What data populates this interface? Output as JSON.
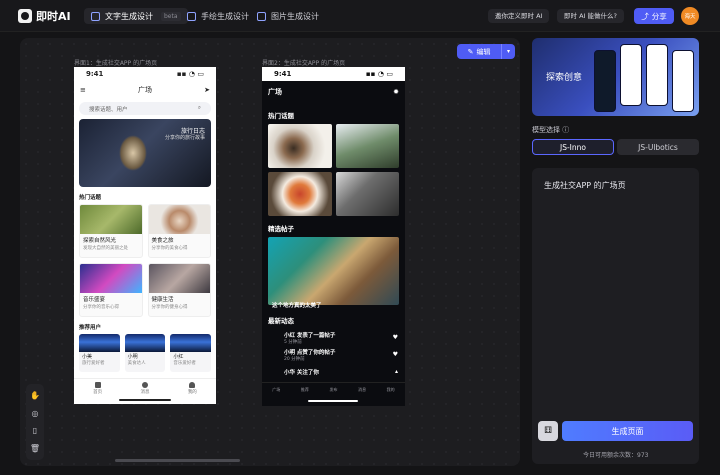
{
  "app": {
    "name": "即时AI"
  },
  "tabs": [
    {
      "label": "文字生成设计",
      "badge": "beta",
      "active": true
    },
    {
      "label": "手绘生成设计",
      "active": false
    },
    {
      "label": "图片生成设计",
      "active": false
    }
  ],
  "header": {
    "custom_link": "邀你定义即时 AI",
    "what_link": "即时 AI 能做什么?",
    "share_label": "分享",
    "avatar_text": "海天"
  },
  "canvas": {
    "frame1_label": "界面1：生成社交APP 的广场页",
    "frame2_label": "界面2：生成社交APP 的广场页",
    "edit_label": "编辑"
  },
  "phone1": {
    "time": "9:41",
    "title": "广场",
    "search_placeholder": "搜索话题、用户",
    "banner_title": "旅行日志",
    "banner_sub": "分享你的旅行故事",
    "section_hot": "热门话题",
    "cards": [
      {
        "title": "探索自然风光",
        "sub": "发现大自然的美丽之处"
      },
      {
        "title": "美食之旅",
        "sub": "分享你的美食心得"
      },
      {
        "title": "音乐盛宴",
        "sub": "分享你的音乐心得"
      },
      {
        "title": "健康生活",
        "sub": "分享你的健身心得"
      }
    ],
    "section_users": "推荐用户",
    "users": [
      {
        "name": "小美",
        "sub": "旅行爱好者"
      },
      {
        "name": "小明",
        "sub": "美食达人"
      },
      {
        "name": "小红",
        "sub": "音乐爱好者"
      }
    ],
    "tabbar": [
      "首页",
      "消息",
      "我的"
    ]
  },
  "phone2": {
    "time": "9:41",
    "title": "广场",
    "section_hot": "热门话题",
    "section_featured": "精选帖子",
    "featured_caption": "这个地方真的太美了",
    "section_activity": "最新动态",
    "activities": [
      {
        "text": "小红 发表了一篇帖子",
        "time": "5 分钟前"
      },
      {
        "text": "小明 点赞了你的帖子",
        "time": "20 分钟前"
      },
      {
        "text": "小华 关注了你",
        "time": ""
      }
    ],
    "tabbar": [
      "广场",
      "推荐",
      "发布",
      "消息",
      "我的"
    ]
  },
  "right": {
    "promo_text": "探索创意",
    "model_label": "模型选择",
    "models": [
      "JS-Inno",
      "JS-Ulbotics"
    ],
    "prompt_text": "生成社交APP 的广场页",
    "generate_label": "生成页面",
    "remain_text": "今日可用额余次数：973"
  },
  "colors": {
    "accent": "#4f5cf5",
    "background": "#141416",
    "panel": "#1e1e22"
  }
}
